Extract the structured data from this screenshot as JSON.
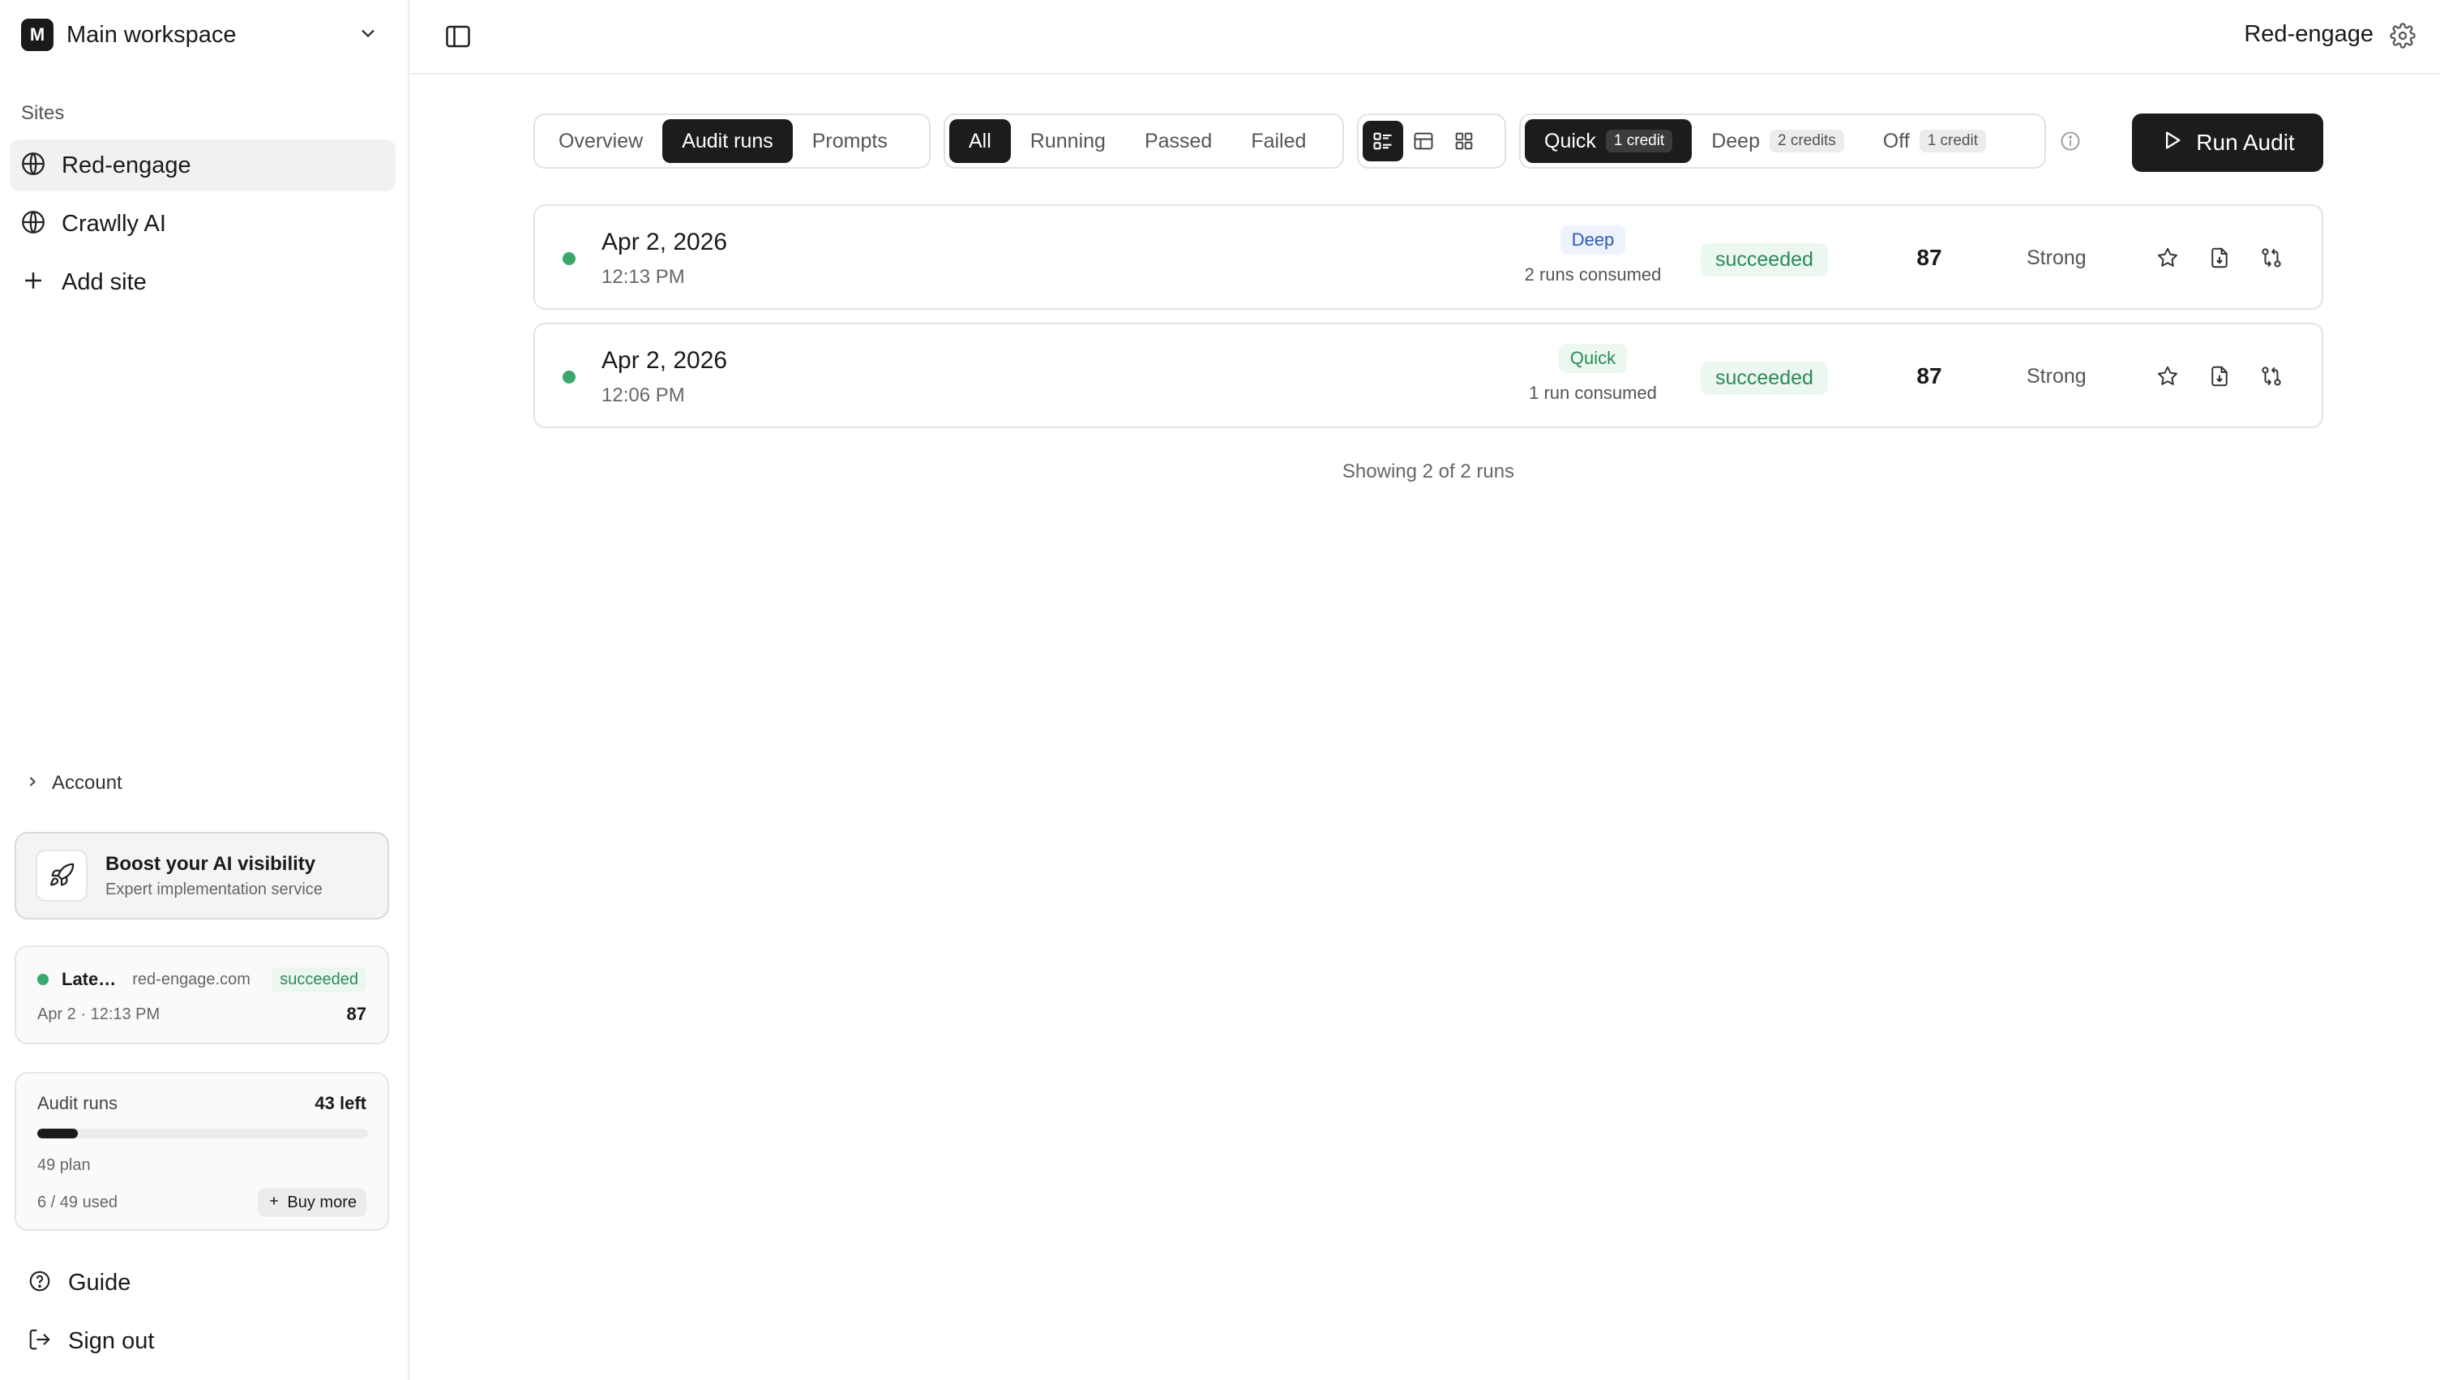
{
  "workspace": {
    "badge": "M",
    "name": "Main workspace"
  },
  "sidebar": {
    "sites_label": "Sites",
    "sites": [
      {
        "label": "Red-engage",
        "active": true
      },
      {
        "label": "Crawlly AI",
        "active": false
      }
    ],
    "add_site": "Add site",
    "account": "Account",
    "boost": {
      "title": "Boost your AI visibility",
      "subtitle": "Expert implementation service"
    },
    "latest": {
      "title": "Late…",
      "domain": "red-engage.com",
      "status": "succeeded",
      "time": "Apr 2 · 12:13 PM",
      "score": "87"
    },
    "credits": {
      "title": "Audit runs",
      "left": "43 left",
      "plan": "49 plan",
      "used": "6 / 49 used",
      "used_fraction": 0.1224,
      "buy_more": "Buy more"
    },
    "guide": "Guide",
    "sign_out": "Sign out"
  },
  "header": {
    "site_title": "Red-engage"
  },
  "tabs": [
    {
      "label": "Overview",
      "active": false
    },
    {
      "label": "Audit runs",
      "active": true
    },
    {
      "label": "Prompts",
      "active": false
    }
  ],
  "filters": [
    {
      "label": "All",
      "active": true
    },
    {
      "label": "Running",
      "active": false
    },
    {
      "label": "Passed",
      "active": false
    },
    {
      "label": "Failed",
      "active": false
    }
  ],
  "views": [
    {
      "icon": "list-view-icon",
      "active": true
    },
    {
      "icon": "table-view-icon",
      "active": false
    },
    {
      "icon": "grid-view-icon",
      "active": false
    }
  ],
  "modes": [
    {
      "label": "Quick",
      "credit": "1 credit",
      "active": true
    },
    {
      "label": "Deep",
      "credit": "2 credits",
      "active": false
    },
    {
      "label": "Off",
      "credit": "1 credit",
      "active": false
    }
  ],
  "run_audit_label": "Run Audit",
  "runs": [
    {
      "date": "Apr 2, 2026",
      "time": "12:13 PM",
      "mode": "Deep",
      "consumed": "2 runs consumed",
      "status": "succeeded",
      "score": "87",
      "grade": "Strong"
    },
    {
      "date": "Apr 2, 2026",
      "time": "12:06 PM",
      "mode": "Quick",
      "consumed": "1 run consumed",
      "status": "succeeded",
      "score": "87",
      "grade": "Strong"
    }
  ],
  "showing": "Showing 2 of 2 runs",
  "colors": {
    "accent_dark": "#1c1c1c",
    "success": "#2b8a57",
    "success_bg": "#ecf7f0",
    "deep": "#2f58b8"
  }
}
